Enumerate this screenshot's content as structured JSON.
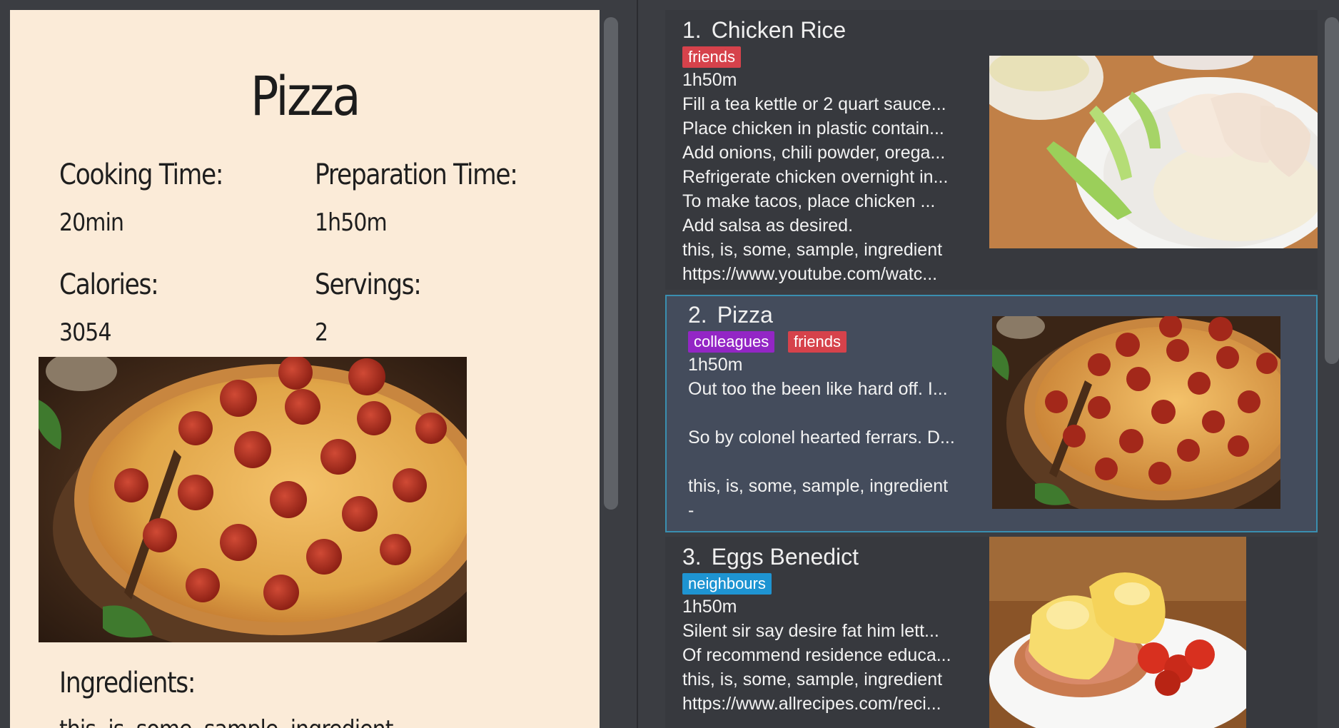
{
  "detail": {
    "title": "Pizza",
    "cooking_time_label": "Cooking Time:",
    "cooking_time_value": "20min",
    "prep_time_label": "Preparation Time:",
    "prep_time_value": "1h50m",
    "calories_label": "Calories:",
    "calories_value": "3054",
    "servings_label": "Servings:",
    "servings_value": "2",
    "ingredients_label": "Ingredients:",
    "ingredients_value": "this, is, some, sample, ingredient"
  },
  "recipes": [
    {
      "index": "1.",
      "name": "Chicken Rice",
      "tags": [
        "friends"
      ],
      "time": "1h50m",
      "lines": [
        "Fill a tea kettle or 2 quart sauce...",
        "Place chicken in plastic contain...",
        "Add onions, chili powder, orega...",
        "Refrigerate chicken overnight in...",
        "To make tacos, place chicken ...",
        "Add salsa as desired.",
        "this, is, some, sample, ingredient",
        "https://www.youtube.com/watc..."
      ]
    },
    {
      "index": "2.",
      "name": "Pizza",
      "tags": [
        "colleagues",
        "friends"
      ],
      "time": "1h50m",
      "lines": [
        "Out too the been like hard off. I...",
        "So by colonel hearted ferrars. D...",
        "this, is, some, sample, ingredient",
        "-"
      ]
    },
    {
      "index": "3.",
      "name": "Eggs Benedict",
      "tags": [
        "neighbours"
      ],
      "time": "1h50m",
      "lines": [
        "Silent sir say desire fat him lett...",
        "Of recommend residence educa...",
        "this, is, some, sample, ingredient",
        "https://www.allrecipes.com/reci..."
      ]
    }
  ],
  "colors": {
    "tag_friends": "#d6424b",
    "tag_colleagues": "#9326c5",
    "tag_neighbours": "#1e94d2",
    "selected_border": "#3a8fb0",
    "detail_background": "#fbebd8"
  },
  "icons": [
    "pizza-photo",
    "chicken-rice-photo",
    "eggs-benedict-photo"
  ]
}
